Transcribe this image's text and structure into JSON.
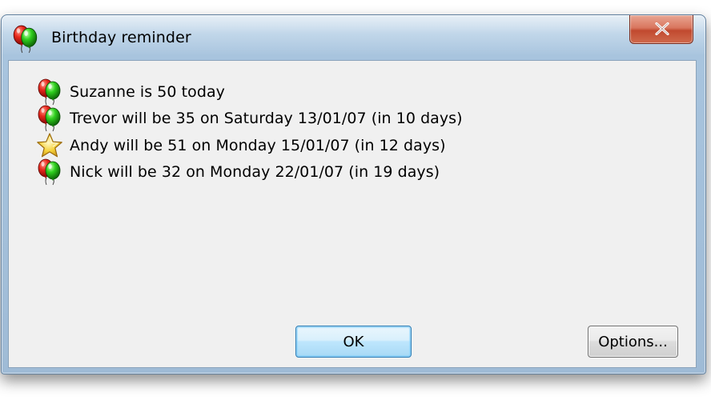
{
  "window": {
    "title": "Birthday reminder",
    "title_icon": "balloons-icon",
    "close_label": "close",
    "accent_close": "#c9583c",
    "frame_color": "#a8c4de"
  },
  "reminders": [
    {
      "icon": "balloons-icon",
      "text": "Suzanne is 50 today"
    },
    {
      "icon": "balloons-icon",
      "text": "Trevor will be 35 on Saturday 13/01/07 (in 10 days)"
    },
    {
      "icon": "star-icon",
      "text": "Andy will be 51 on Monday 15/01/07 (in 12 days)"
    },
    {
      "icon": "balloons-icon",
      "text": "Nick will be 32 on Monday 22/01/07 (in 19 days)"
    }
  ],
  "buttons": {
    "ok_label": "OK",
    "options_label": "Options..."
  }
}
